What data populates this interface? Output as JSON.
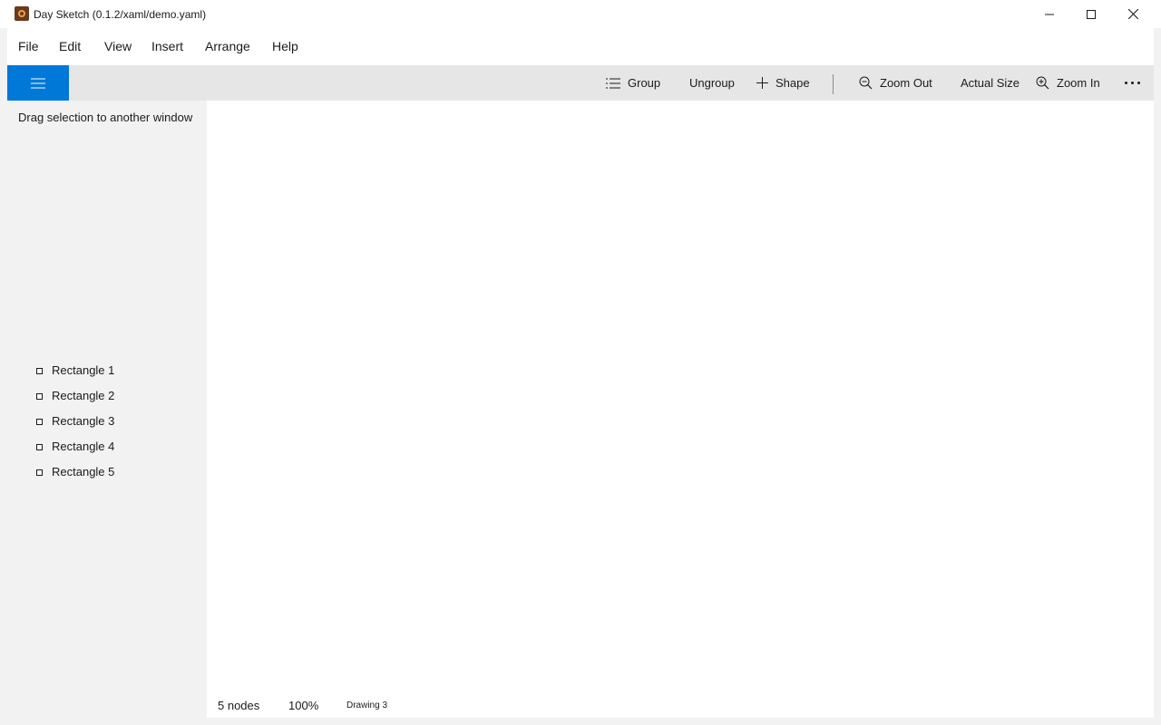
{
  "window": {
    "title": "Day Sketch (0.1.2/xaml/demo.yaml)",
    "app_icon": "day-sketch-app-icon"
  },
  "menu": {
    "items": [
      "File",
      "Edit",
      "View",
      "Insert",
      "Arrange",
      "Help"
    ]
  },
  "toolbar": {
    "group_label": "Group",
    "group_icon": "list-icon",
    "ungroup_label": "Ungroup",
    "shape_label": "Shape",
    "shape_icon": "plus-icon",
    "zoom_out_label": "Zoom Out",
    "zoom_out_icon": "zoom-out-icon",
    "actual_size_label": "Actual Size",
    "zoom_in_label": "Zoom In",
    "zoom_in_icon": "zoom-in-icon",
    "accent_color": "#0078d7"
  },
  "sidebar": {
    "drag_hint": "Drag selection to another window",
    "nodes": [
      {
        "label": "Rectangle 1"
      },
      {
        "label": "Rectangle 2"
      },
      {
        "label": "Rectangle 3"
      },
      {
        "label": "Rectangle 4"
      },
      {
        "label": "Rectangle 5"
      }
    ]
  },
  "status": {
    "node_count": "5 nodes",
    "zoom": "100%",
    "drawing_name": "Drawing 3"
  }
}
